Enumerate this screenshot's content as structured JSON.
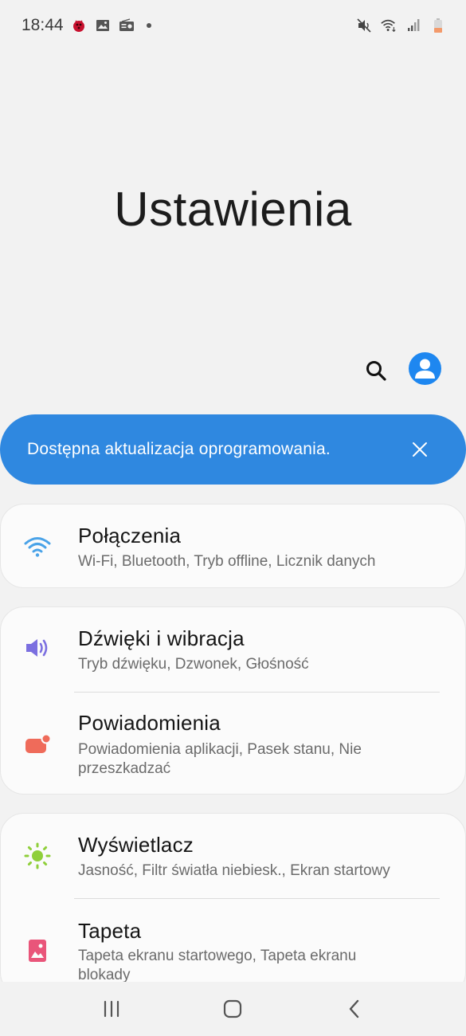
{
  "status_bar": {
    "time": "18:44",
    "left_icons": [
      "bug-notification-icon",
      "image-notification-icon",
      "radio-notification-icon"
    ],
    "right_icons": [
      "mute-icon",
      "wifi-icon",
      "signal-icon",
      "battery-icon"
    ]
  },
  "header": {
    "title": "Ustawienia"
  },
  "banner": {
    "text": "Dostępna aktualizacja oprogramowania."
  },
  "settings": [
    {
      "title": "Połączenia",
      "subtitle": "Wi-Fi, Bluetooth, Tryb offline, Licznik danych",
      "icon": "wifi-icon",
      "color": "#4aa3e8"
    },
    {
      "title": "Dźwięki i wibracja",
      "subtitle": "Tryb dźwięku, Dzwonek, Głośność",
      "icon": "speaker-icon",
      "color": "#7b6fe0"
    },
    {
      "title": "Powiadomienia",
      "subtitle": "Powiadomienia aplikacji, Pasek stanu, Nie przeszkadzać",
      "icon": "notification-icon",
      "color": "#ef6b5a"
    },
    {
      "title": "Wyświetlacz",
      "subtitle": "Jasność, Filtr światła niebiesk., Ekran startowy",
      "icon": "brightness-icon",
      "color": "#8fcf3a"
    },
    {
      "title": "Tapeta",
      "subtitle": "Tapeta ekranu startowego, Tapeta ekranu blokady",
      "icon": "wallpaper-icon",
      "color": "#e9557a"
    }
  ],
  "colors": {
    "accent": "#2f88e0",
    "background": "#f2f2f2",
    "card": "#fbfbfb"
  }
}
